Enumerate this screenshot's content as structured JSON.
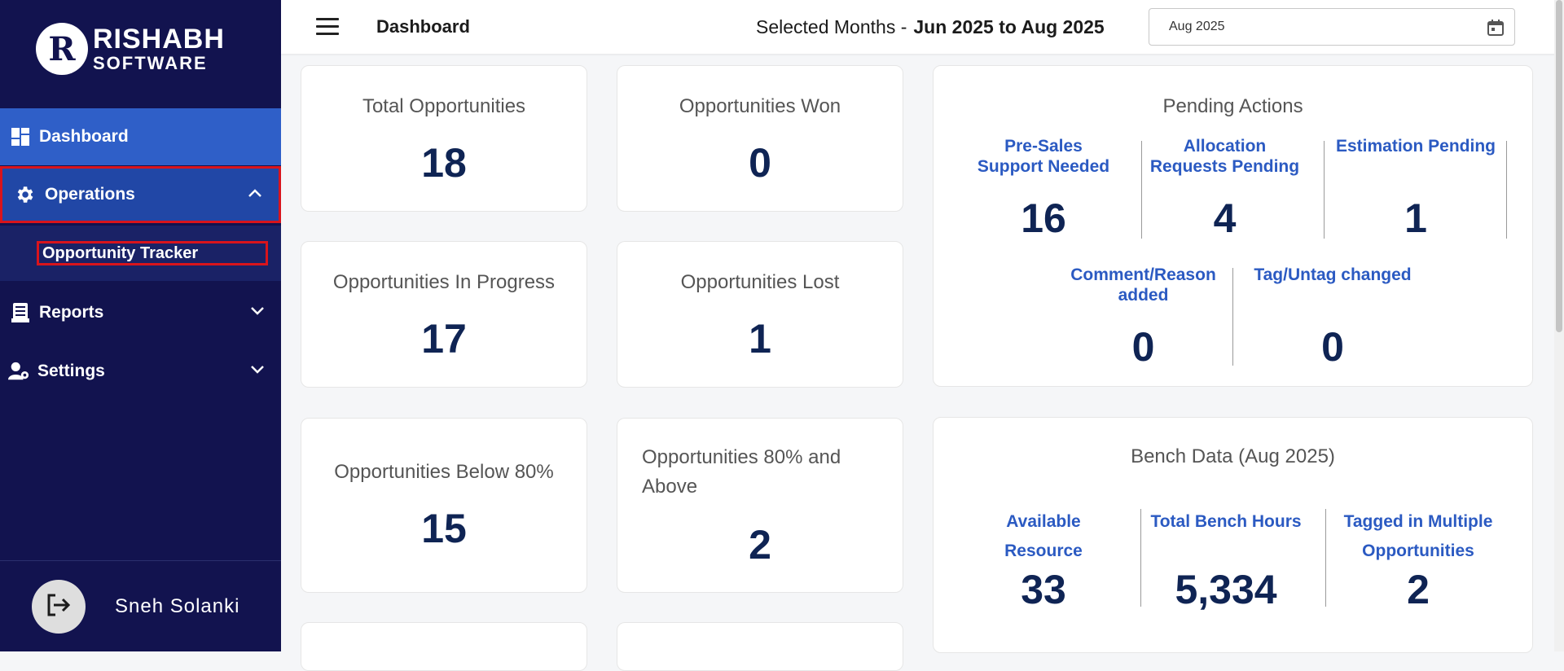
{
  "sidebar": {
    "logo": {
      "mark": "R",
      "line1": "RISHABH",
      "line2": "SOFTWARE"
    },
    "items": [
      {
        "label": "Dashboard",
        "icon": "dashboard-icon"
      },
      {
        "label": "Operations",
        "icon": "gear-icon",
        "expanded": true,
        "children": [
          {
            "label": "Opportunity Tracker"
          }
        ]
      },
      {
        "label": "Reports",
        "icon": "report-icon"
      },
      {
        "label": "Settings",
        "icon": "user-settings-icon"
      }
    ],
    "user": {
      "name": "Sneh Solanki"
    }
  },
  "header": {
    "title": "Dashboard",
    "selected_months_label": "Selected Months -",
    "selected_months_value": "Jun 2025 to Aug 2025",
    "date_picker": {
      "value": "Aug 2025",
      "icon": "calendar-icon"
    }
  },
  "metrics": [
    {
      "title": "Total Opportunities",
      "value": "18"
    },
    {
      "title": "Opportunities Won",
      "value": "0"
    },
    {
      "title": "Opportunities In Progress",
      "value": "17"
    },
    {
      "title": "Opportunities Lost",
      "value": "1"
    },
    {
      "title": "Opportunities Below 80%",
      "value": "15"
    },
    {
      "title": "Opportunities 80% and Above",
      "value": "2"
    }
  ],
  "pending_actions": {
    "title": "Pending Actions",
    "items": [
      {
        "label": "Pre-Sales Support Needed",
        "value": "16"
      },
      {
        "label": "Allocation Requests Pending",
        "value": "4"
      },
      {
        "label": "Estimation Pending",
        "value": "1"
      },
      {
        "label": "Comment/Reason added",
        "value": "0"
      },
      {
        "label": "Tag/Untag changed",
        "value": "0"
      }
    ]
  },
  "bench_data": {
    "title": "Bench Data (Aug 2025)",
    "items": [
      {
        "label": "Available Resource",
        "value": "33"
      },
      {
        "label": "Total Bench Hours",
        "value": "5,334"
      },
      {
        "label": "Tagged in Multiple Opportunities",
        "value": "2"
      }
    ]
  },
  "colors": {
    "sidebar_bg": "#12134f",
    "active_item": "#2f5fc8",
    "highlight_border": "#d9141c",
    "value_text": "#0f2454",
    "link_label": "#2b5ac2"
  }
}
